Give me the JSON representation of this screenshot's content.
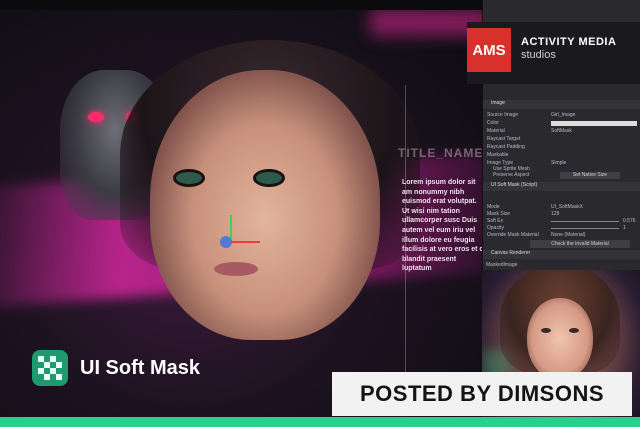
{
  "product": {
    "title": "UI Soft Mask"
  },
  "scene": {
    "title_text": "TITLE_NAME",
    "lorem_text": "Lorem ipsum dolor sit am nonummy nibh euismod erat volutpat. Ut wisi nim tation ullamcorper susc Duis autem vel eum iriu vel illum dolore eu feugia facilisis at vero eros et c blandit praesent luptatum"
  },
  "brand": {
    "badge": "AMS",
    "name": "ACTIVITY MEDIA",
    "sub": "studios"
  },
  "inspector": {
    "image_section": "Image",
    "rows": [
      {
        "label": "Source Image",
        "value": "Girl_Image"
      },
      {
        "label": "Color",
        "value": ""
      },
      {
        "label": "Material",
        "value": "SoftMask"
      },
      {
        "label": "Raycast Target",
        "value": ""
      },
      {
        "label": "Raycast Padding",
        "value": ""
      },
      {
        "label": "Maskable",
        "value": ""
      },
      {
        "label": "Image Type",
        "value": "Simple"
      },
      {
        "label": "Use Sprite Mesh",
        "value": ""
      },
      {
        "label": "Preserve Aspect",
        "value": ""
      }
    ],
    "set_native": "Set Native Size",
    "soft_section": "UI Soft Mask (Script)",
    "soft_rows": [
      {
        "label": "Mode",
        "value": "UI_SoftMaskX"
      },
      {
        "label": "Mask Size",
        "value": "128"
      },
      {
        "label": "Soft Ex",
        "value": "0.576"
      },
      {
        "label": "Opacity",
        "value": "1"
      },
      {
        "label": "Override Mask Material",
        "value": "None (Material)"
      }
    ],
    "check_button": "Check the Invalid Material",
    "canvas_section": "Canvas Renderer",
    "preview_label": "MaskedImage"
  },
  "banner": {
    "text": "POSTED BY DIMSONS"
  },
  "colors": {
    "accent": "#23d38c",
    "brand_red": "#d8302a",
    "magenta": "#e628aa"
  }
}
